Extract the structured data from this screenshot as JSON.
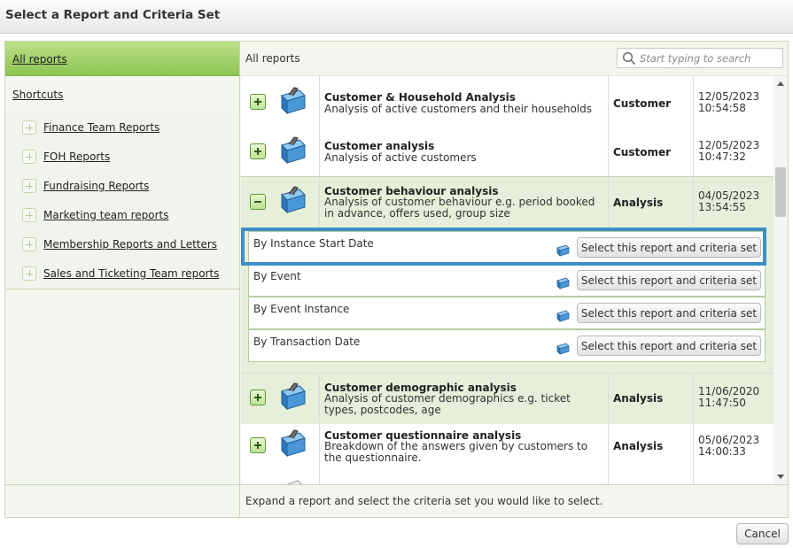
{
  "dialog": {
    "title": "Select a Report and Criteria Set"
  },
  "sidebar": {
    "all_reports": "All reports",
    "shortcuts": "Shortcuts",
    "folders": [
      "Finance Team Reports",
      "FOH Reports",
      "Fundraising Reports",
      "Marketing team reports",
      "Membership Reports and Letters",
      "Sales and Ticketing Team reports"
    ]
  },
  "main": {
    "breadcrumb": "All reports",
    "search_placeholder": "Start typing to search"
  },
  "reports": [
    {
      "title": "Customer & Household Analysis",
      "desc": "Analysis of active customers and their households",
      "category": "Customer",
      "date": "12/05/2023",
      "time": "10:54:58"
    },
    {
      "title": "Customer analysis",
      "desc": "Analysis of active customers",
      "category": "Customer",
      "date": "12/05/2023",
      "time": "10:47:32"
    },
    {
      "title": "Customer behaviour analysis",
      "desc": "Analysis of customer behaviour e.g. period booked in advance, offers used, group size",
      "category": "Analysis",
      "date": "04/05/2023",
      "time": "13:54:55",
      "expanded": true
    },
    {
      "title": "Customer demographic analysis",
      "desc": "Analysis of customer demographics e.g. ticket types, postcodes, age",
      "category": "Analysis",
      "date": "11/06/2020",
      "time": "11:47:50"
    },
    {
      "title": "Customer questionnaire analysis",
      "desc": "Breakdown of the answers given by customers to the questionnaire.",
      "category": "Analysis",
      "date": "05/06/2023",
      "time": "14:00:33"
    }
  ],
  "criteria_sets": [
    {
      "label": "By Instance Start Date",
      "button": "Select this report and criteria set",
      "highlighted": true
    },
    {
      "label": "By Event",
      "button": "Select this report and criteria set"
    },
    {
      "label": "By Event Instance",
      "button": "Select this report and criteria set"
    },
    {
      "label": "By Transaction Date",
      "button": "Select this report and criteria set"
    }
  ],
  "footer": {
    "hint": "Expand a report and select the criteria set you would like to select."
  },
  "buttons": {
    "cancel": "Cancel"
  },
  "colors": {
    "accent_green": "#8cc452",
    "highlight_blue": "#3f8fc6",
    "expanded_bg": "#e5efd9"
  }
}
